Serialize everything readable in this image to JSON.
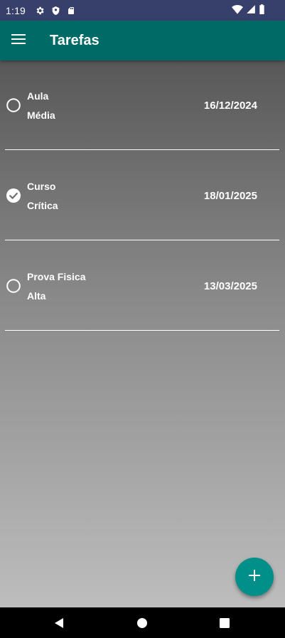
{
  "status_bar": {
    "time": "1:19",
    "icons": [
      "settings-icon",
      "shield-icon",
      "sd-card-icon",
      "wifi-icon",
      "signal-icon",
      "battery-icon"
    ]
  },
  "app_bar": {
    "title": "Tarefas",
    "menu_icon": "hamburger-menu-icon"
  },
  "tasks": [
    {
      "title": "Aula",
      "priority": "Média",
      "date": "16/12/2024",
      "completed": false
    },
    {
      "title": "Curso",
      "priority": "Crítica",
      "date": "18/01/2025",
      "completed": true
    },
    {
      "title": "Prova Fisica",
      "priority": "Alta",
      "date": "13/03/2025",
      "completed": false
    }
  ],
  "fab": {
    "icon": "plus-icon"
  },
  "nav_bar": {
    "icons": [
      "back-icon",
      "home-icon",
      "recents-icon"
    ]
  },
  "colors": {
    "status_bar": "#37406a",
    "app_bar": "#006a66",
    "fab": "#009089"
  }
}
